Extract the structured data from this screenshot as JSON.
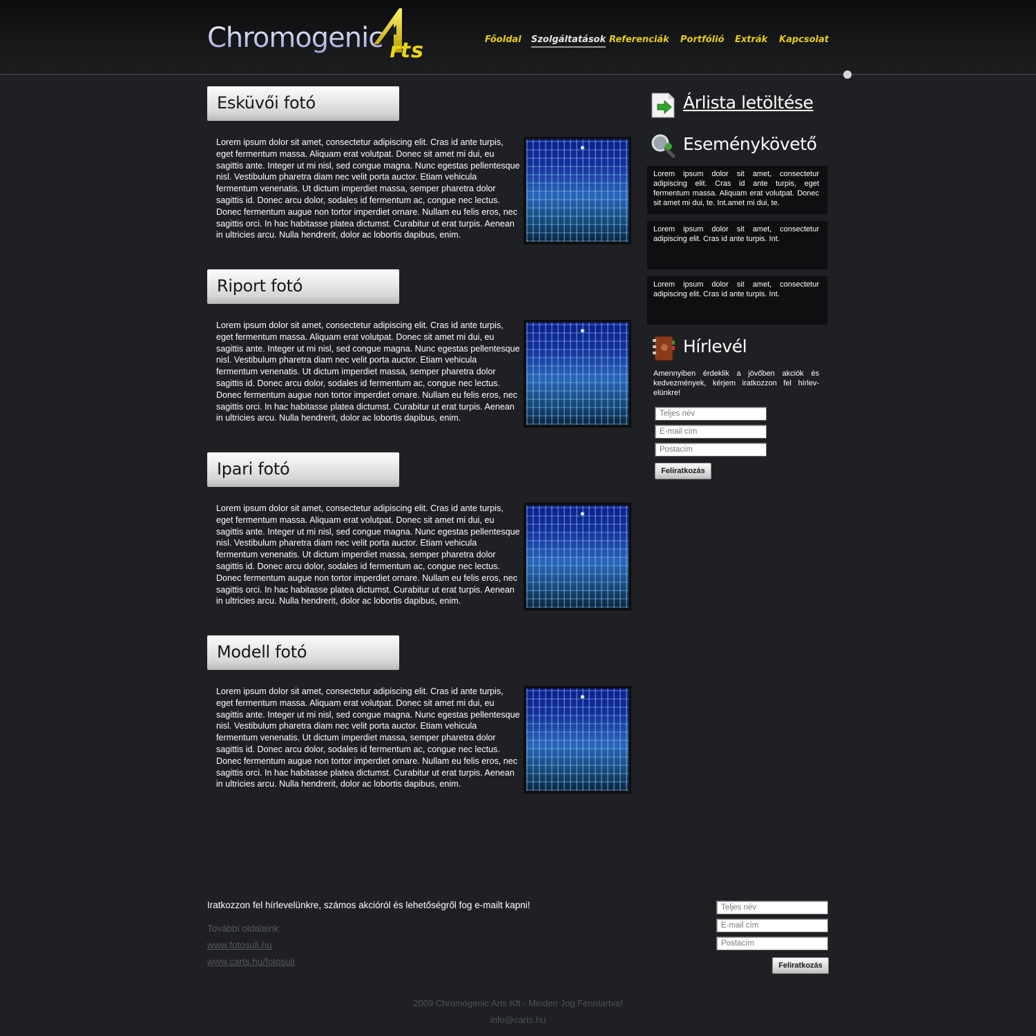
{
  "header": {
    "logo_main": "Chromogenic",
    "logo_suffix": "rts",
    "nav": [
      {
        "label": "Főoldal",
        "active": false
      },
      {
        "label": "Szolgáltatások",
        "active": true
      },
      {
        "label": "Referenciák",
        "active": false
      },
      {
        "label": "Portfólió",
        "active": false
      },
      {
        "label": "Extrák",
        "active": false
      },
      {
        "label": "Kapcsolat",
        "active": false
      }
    ]
  },
  "sections": [
    {
      "title": "Esküvői fotó",
      "text": "Lorem ipsum dolor sit amet, consectetur adipiscing elit. Cras id ante turpis, eget fermentum massa. Aliquam erat volutpat. Donec sit amet mi dui, eu sagittis ante. Integer ut mi nisl, sed congue magna. Nunc egestas pellentesque nisl. Vestibulum pharetra diam nec velit porta auctor. Etiam vehicula fermentum venenatis. Ut dictum imperdiet massa, semper pharetra dolor sagittis id. Donec arcu dolor, sodales id fermentum ac, congue nec lectus. Donec fermentum augue non tortor imperdiet ornare. Nullam eu felis eros, nec sagittis orci. In hac habitasse platea dictumst. Curabitur ut erat turpis. Aenean in ultricies arcu. Nulla hendrerit, dolor ac lobortis dapibus, enim."
    },
    {
      "title": "Riport fotó",
      "text": "Lorem ipsum dolor sit amet, consectetur adipiscing elit. Cras id ante turpis, eget fermentum massa. Aliquam erat volutpat. Donec sit amet mi dui, eu sagittis ante. Integer ut mi nisl, sed congue magna. Nunc egestas pellentesque nisl. Vestibulum pharetra diam nec velit porta auctor. Etiam vehicula fermentum venenatis. Ut dictum imperdiet massa, semper pharetra dolor sagittis id. Donec arcu dolor, sodales id fermentum ac, congue nec lectus. Donec fermentum augue non tortor imperdiet ornare. Nullam eu felis eros, nec sagittis orci. In hac habitasse platea dictumst. Curabitur ut erat turpis. Aenean in ultricies arcu. Nulla hendrerit, dolor ac lobortis dapibus, enim."
    },
    {
      "title": "Ipari fotó",
      "text": "Lorem ipsum dolor sit amet, consectetur adipiscing elit. Cras id ante turpis, eget fermentum massa. Aliquam erat volutpat. Donec sit amet mi dui, eu sagittis ante. Integer ut mi nisl, sed congue magna. Nunc egestas pellentesque nisl. Vestibulum pharetra diam nec velit porta auctor. Etiam vehicula fermentum venenatis. Ut dictum imperdiet massa, semper pharetra dolor sagittis id. Donec arcu dolor, sodales id fermentum ac, congue nec lectus. Donec fermentum augue non tortor imperdiet ornare. Nullam eu felis eros, nec sagittis orci. In hac habitasse platea dictumst. Curabitur ut erat turpis. Aenean in ultricies arcu. Nulla hendrerit, dolor ac lobortis dapibus, enim."
    },
    {
      "title": "Modell fotó",
      "text": "Lorem ipsum dolor sit amet, consectetur adipiscing elit. Cras id ante turpis, eget fermentum massa. Aliquam erat volutpat. Donec sit amet mi dui, eu sagittis ante. Integer ut mi nisl, sed congue magna. Nunc egestas pellentesque nisl. Vestibulum pharetra diam nec velit porta auctor. Etiam vehicula fermentum venenatis. Ut dictum imperdiet massa, semper pharetra dolor sagittis id. Donec arcu dolor, sodales id fermentum ac, congue nec lectus. Donec fermentum augue non tortor imperdiet ornare. Nullam eu felis eros, nec sagittis orci. In hac habitasse platea dictumst. Curabitur ut erat turpis. Aenean in ultricies arcu. Nulla hendrerit, dolor ac lobortis dapibus, enim."
    }
  ],
  "sidebar": {
    "pricelist": {
      "label": "Árlista letöltése",
      "icon": "download-document-icon"
    },
    "events": {
      "title": "Eseménykövető",
      "icon": "magnifier-icon",
      "items": [
        "Lorem ipsum dolor sit amet, consectetur adipiscing elit. Cras id ante turpis, eget fermentum massa. Aliquam erat volutpat. Donec sit amet mi dui, te. Int.amet mi dui, te.",
        "Lorem ipsum dolor sit amet, consectetur adipiscing elit. Cras id ante turpis. Int.",
        "Lorem ipsum dolor sit amet, consectetur adipiscing elit. Cras id ante turpis. Int."
      ]
    },
    "newsletter": {
      "title": "Hírlevél",
      "icon": "address-book-icon",
      "text": "Amennyiben érdeklik a jövőben akciók és kedvezmények, kérjem iratkozzon fel hírlev-elünkre!",
      "name_placeholder": "Teljes név",
      "email_placeholder": "E-mail cím",
      "address_placeholder": "Postacím",
      "button": "Feliratkozás"
    }
  },
  "footer": {
    "signup_text": "Iratkozzon fel hírlevelünkre, számos akcióról és lehetőségről fog e-mailt kapni!",
    "more_label": "További oldalaink:",
    "links": [
      "www.fotosuli.hu",
      "www.carts.hu/fotosuli"
    ],
    "name_placeholder": "Teljes név",
    "email_placeholder": "E-mail cím",
    "address_placeholder": "Postacím",
    "button": "Feliratkozás",
    "copyright": "2009 Chromogenic Arts Kft - Minden Jog Fenntartva!",
    "email": "info@carts.hu"
  },
  "colors": {
    "background": "#1e2023",
    "nav_text": "#e5cc1a",
    "logo_yellow": "#e9d518"
  }
}
